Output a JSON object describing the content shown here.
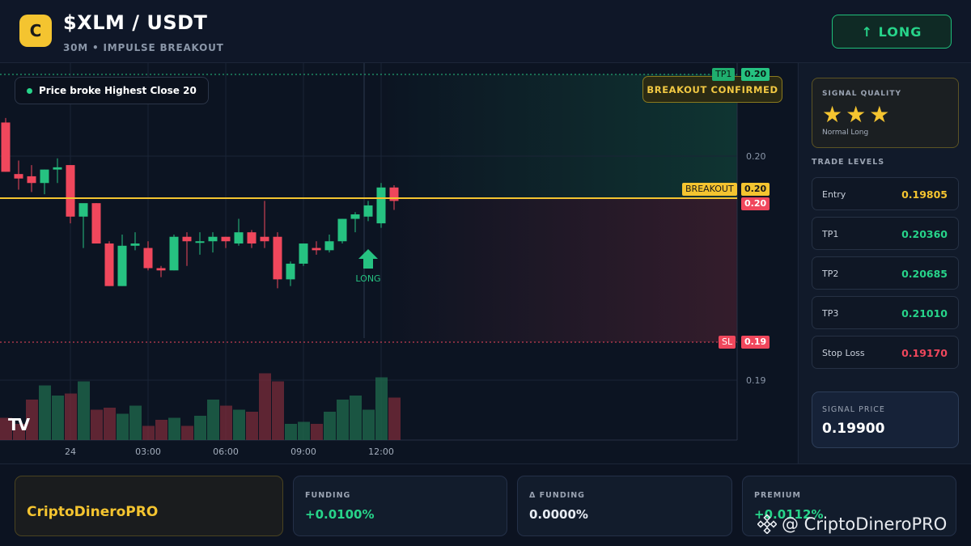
{
  "header": {
    "coin_letter": "C",
    "pair": "$XLM / USDT",
    "subtitle": "30M • IMPULSE BREAKOUT",
    "signal_button": "↑ LONG"
  },
  "chart": {
    "callout": "Price broke Highest Close 20",
    "badge": "BREAKOUT CONFIRMED",
    "logo_text": "TV",
    "long_marker_label": "LONG",
    "levels": {
      "tp1_tag": "TP1",
      "tp1_price": "0.20",
      "breakout_tag": "BREAKOUT",
      "breakout_price": "0.20",
      "current_price": "0.20",
      "sl_tag": "SL",
      "sl_price": "0.19"
    },
    "y_ticks": [
      "0.20",
      "0.19"
    ],
    "x_ticks": [
      "24",
      "03:00",
      "06:00",
      "09:00",
      "12:00"
    ],
    "colors": {
      "up": "#26c281",
      "down": "#f0475c",
      "breakout": "#f4c430"
    }
  },
  "chart_data": {
    "type": "candlestick",
    "candles": [
      {
        "o": 0.2015,
        "h": 0.2017,
        "l": 0.1993,
        "c": 0.1993
      },
      {
        "o": 0.1992,
        "h": 0.1998,
        "l": 0.1985,
        "c": 0.199
      },
      {
        "o": 0.1991,
        "h": 0.1996,
        "l": 0.1984,
        "c": 0.1988
      },
      {
        "o": 0.1988,
        "h": 0.1994,
        "l": 0.1983,
        "c": 0.1994
      },
      {
        "o": 0.1994,
        "h": 0.1999,
        "l": 0.1988,
        "c": 0.1995
      },
      {
        "o": 0.1996,
        "h": 0.1996,
        "l": 0.197,
        "c": 0.1973
      },
      {
        "o": 0.1973,
        "h": 0.1978,
        "l": 0.1959,
        "c": 0.1979
      },
      {
        "o": 0.1979,
        "h": 0.1979,
        "l": 0.1961,
        "c": 0.1961
      },
      {
        "o": 0.1961,
        "h": 0.1962,
        "l": 0.1942,
        "c": 0.1942
      },
      {
        "o": 0.1942,
        "h": 0.1965,
        "l": 0.1942,
        "c": 0.196
      },
      {
        "o": 0.196,
        "h": 0.1966,
        "l": 0.1958,
        "c": 0.1961
      },
      {
        "o": 0.1959,
        "h": 0.1962,
        "l": 0.1949,
        "c": 0.195
      },
      {
        "o": 0.195,
        "h": 0.1951,
        "l": 0.1946,
        "c": 0.1949
      },
      {
        "o": 0.1949,
        "h": 0.1965,
        "l": 0.1949,
        "c": 0.1964
      },
      {
        "o": 0.1964,
        "h": 0.1966,
        "l": 0.1951,
        "c": 0.1962
      },
      {
        "o": 0.1962,
        "h": 0.1966,
        "l": 0.1956,
        "c": 0.1962
      },
      {
        "o": 0.1962,
        "h": 0.1966,
        "l": 0.1957,
        "c": 0.1964
      },
      {
        "o": 0.1964,
        "h": 0.1964,
        "l": 0.1959,
        "c": 0.1962
      },
      {
        "o": 0.1961,
        "h": 0.1972,
        "l": 0.196,
        "c": 0.1966
      },
      {
        "o": 0.1966,
        "h": 0.1967,
        "l": 0.1959,
        "c": 0.1961
      },
      {
        "o": 0.1964,
        "h": 0.198,
        "l": 0.1959,
        "c": 0.1962
      },
      {
        "o": 0.1964,
        "h": 0.1966,
        "l": 0.1941,
        "c": 0.1945
      },
      {
        "o": 0.1945,
        "h": 0.1953,
        "l": 0.1942,
        "c": 0.1952
      },
      {
        "o": 0.1952,
        "h": 0.1961,
        "l": 0.1951,
        "c": 0.1961
      },
      {
        "o": 0.1959,
        "h": 0.1962,
        "l": 0.1956,
        "c": 0.1958
      },
      {
        "o": 0.1958,
        "h": 0.1965,
        "l": 0.1957,
        "c": 0.1962
      },
      {
        "o": 0.1962,
        "h": 0.1972,
        "l": 0.1961,
        "c": 0.1972
      },
      {
        "o": 0.1972,
        "h": 0.1975,
        "l": 0.1966,
        "c": 0.1974
      },
      {
        "o": 0.1973,
        "h": 0.198,
        "l": 0.1971,
        "c": 0.1978
      },
      {
        "o": 0.197,
        "h": 0.1988,
        "l": 0.1968,
        "c": 0.1986
      },
      {
        "o": 0.1986,
        "h": 0.1987,
        "l": 0.1976,
        "c": 0.198
      }
    ],
    "volumes": [
      22,
      16,
      40,
      54,
      44,
      46,
      58,
      30,
      32,
      26,
      34,
      14,
      20,
      22,
      14,
      24,
      40,
      34,
      30,
      28,
      66,
      58,
      16,
      18,
      16,
      28,
      40,
      44,
      30,
      62,
      42
    ],
    "yticks": [
      0.2,
      0.19
    ],
    "ylabel": "",
    "xlabel": ""
  },
  "side": {
    "quality_label": "SIGNAL QUALITY",
    "stars": "★★★",
    "quality_sub": "Normal Long",
    "levels_title": "TRADE LEVELS",
    "levels": [
      {
        "name": "Entry",
        "value": "0.19805",
        "color": "#f4c430"
      },
      {
        "name": "TP1",
        "value": "0.20360",
        "color": "#27d48a"
      },
      {
        "name": "TP2",
        "value": "0.20685",
        "color": "#27d48a"
      },
      {
        "name": "TP3",
        "value": "0.21010",
        "color": "#27d48a"
      },
      {
        "name": "Stop Loss",
        "value": "0.19170",
        "color": "#f0475c"
      }
    ],
    "signal_price_label": "SIGNAL PRICE",
    "signal_price": "0.19900"
  },
  "footer": {
    "brand": "CriptoDineroPRO",
    "funding_label": "FUNDING",
    "funding_value": "+0.0100%",
    "dfunding_label": "Δ FUNDING",
    "dfunding_value": "0.0000%",
    "premium_label": "PREMIUM",
    "premium_value": "+0.0112%",
    "watermark": "@ CriptoDineroPRO"
  }
}
